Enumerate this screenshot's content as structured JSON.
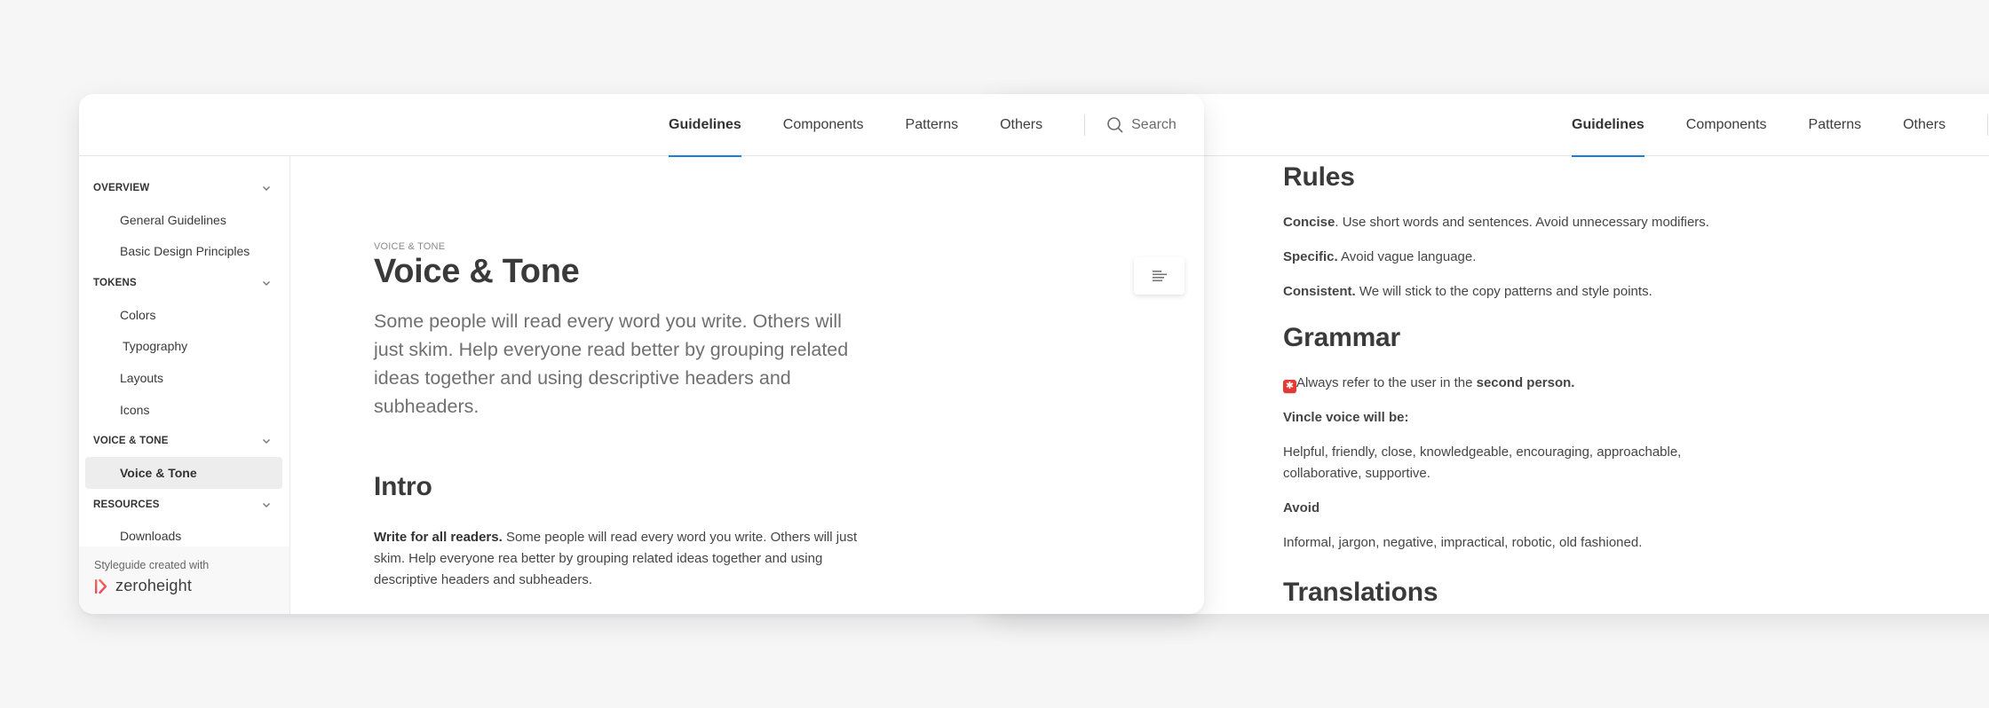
{
  "nav": {
    "tabs": [
      {
        "label": "Guidelines",
        "active": true
      },
      {
        "label": "Components",
        "active": false
      },
      {
        "label": "Patterns",
        "active": false
      },
      {
        "label": "Others",
        "active": false
      }
    ],
    "search_label": "Search",
    "accent_color": "#1a7be0"
  },
  "sidebar": {
    "sections": [
      {
        "label": "OVERVIEW",
        "items": [
          "General Guidelines",
          "Basic Design Principles"
        ]
      },
      {
        "label": "TOKENS",
        "items": [
          "Colors",
          "Typography",
          "Layouts",
          "Icons"
        ]
      },
      {
        "label": "VOICE & TONE",
        "items": [
          "Voice & Tone"
        ]
      },
      {
        "label": "RESOURCES",
        "items": [
          "Downloads"
        ]
      }
    ],
    "active_item": "Voice & Tone",
    "footer": {
      "credit": "Styleguide created with",
      "brand": "zeroheight"
    }
  },
  "page": {
    "eyebrow": "VOICE & TONE",
    "title": "Voice & Tone",
    "lead": "Some people will read every word you write. Others will just skim. Help everyone read better by grouping related ideas together and using descriptive headers and subheaders.",
    "intro": {
      "heading": "Intro",
      "bold": "Write for all readers.",
      "text": " Some people will read every word you write. Others will just skim. Help everyone rea better by grouping related ideas together and using descriptive headers and subheaders."
    }
  },
  "right_page": {
    "rules": {
      "heading": "Rules",
      "items": [
        {
          "bold": "Concise",
          "text": ". Use short words and sentences. Avoid unnecessary modifiers."
        },
        {
          "bold": "Specific.",
          "text": " Avoid vague language."
        },
        {
          "bold": "Consistent.",
          "text": " We will stick to the copy patterns and style points."
        }
      ]
    },
    "grammar": {
      "heading": "Grammar",
      "alert_icon": "alert-emoji",
      "alert_text": "Always refer to the user in the ",
      "alert_bold": "second person.",
      "voice_label": "Vincle voice will be:",
      "voice_text": "Helpful, friendly, close, knowledgeable, encouraging, approachable, collaborative, supportive.",
      "avoid_label": "Avoid",
      "avoid_text": "Informal, jargon, negative, impractical, robotic, old fashioned."
    },
    "translations": {
      "heading": "Translations"
    }
  }
}
